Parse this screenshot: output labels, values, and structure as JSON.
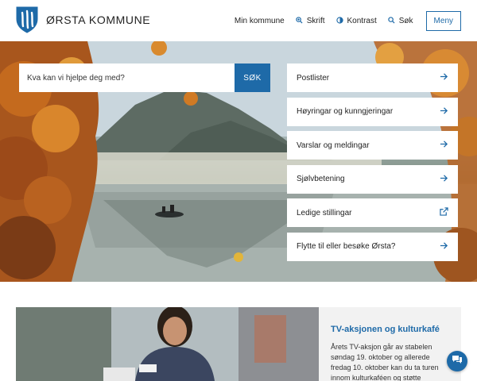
{
  "brand": {
    "name": "ØRSTA KOMMUNE"
  },
  "nav": {
    "items": [
      {
        "label": "Min kommune",
        "icon": ""
      },
      {
        "label": "Skrift",
        "icon": "zoom-icon"
      },
      {
        "label": "Kontrast",
        "icon": "contrast-icon"
      },
      {
        "label": "Søk",
        "icon": "search-icon"
      }
    ],
    "menu_label": "Meny"
  },
  "search": {
    "placeholder": "Kva kan vi hjelpe deg med?",
    "button_label": "SØK"
  },
  "quick_links": [
    {
      "label": "Postlister",
      "icon": "arrow-right-icon"
    },
    {
      "label": "Høyringar og kunngjeringar",
      "icon": "arrow-right-icon"
    },
    {
      "label": "Varslar og meldingar",
      "icon": "arrow-right-icon"
    },
    {
      "label": "Sjølvbetening",
      "icon": "arrow-right-icon"
    },
    {
      "label": "Ledige stillingar",
      "icon": "external-link-icon"
    },
    {
      "label": "Flytte til eller besøke Ørsta?",
      "icon": "arrow-right-icon"
    }
  ],
  "news": {
    "title": "TV-aksjonen og kulturkafé",
    "body": "Årets TV-aksjon går av stabelen søndag 19. oktober og allerede fredag 10. oktober kan du ta turen innom kulturkaféen og støtte"
  },
  "colors": {
    "accent": "#1e6aa8"
  }
}
